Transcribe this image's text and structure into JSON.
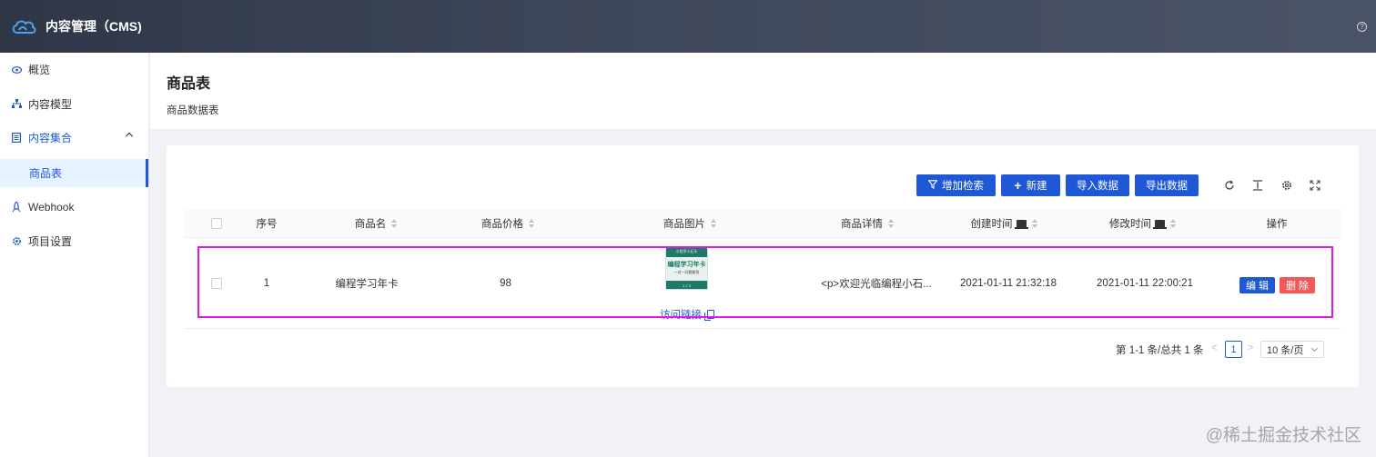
{
  "header": {
    "title": "内容管理（CMS)",
    "help_icon": "?"
  },
  "sidebar": {
    "items": [
      {
        "label": "概览",
        "icon": "eye-icon"
      },
      {
        "label": "内容模型",
        "icon": "sitemap-icon"
      },
      {
        "label": "内容集合",
        "icon": "list-icon"
      },
      {
        "label": "Webhook",
        "icon": "rocket-icon"
      },
      {
        "label": "项目设置",
        "icon": "gear-icon"
      }
    ],
    "sub_item": "商品表"
  },
  "page": {
    "title": "商品表",
    "subtitle": "商品数据表"
  },
  "toolbar": {
    "add_filter": "增加检索",
    "create": "新建",
    "import": "导入数据",
    "export": "导出数据"
  },
  "table": {
    "columns": [
      "序号",
      "商品名",
      "商品价格",
      "商品图片",
      "商品详情",
      "创建时间",
      "修改时间",
      "操作"
    ],
    "rows": [
      {
        "index": "1",
        "name": "编程学习年卡",
        "price": "98",
        "image": {
          "line1": "小程序小石头",
          "line2": "编程学习年卡",
          "line3": "一对一问题解答",
          "line4": "1 2 3"
        },
        "link_label": "访问链接",
        "detail": "<p>欢迎光临编程小石...",
        "created": "2021-01-11 21:32:18",
        "modified": "2021-01-11 22:00:21",
        "edit": "编 辑",
        "delete": "删 除"
      }
    ]
  },
  "pagination": {
    "total": "第 1-1 条/总共 1 条",
    "prev": "<",
    "current": "1",
    "next": ">",
    "page_size": "10 条/页"
  },
  "watermark": "@稀土掘金技术社区"
}
